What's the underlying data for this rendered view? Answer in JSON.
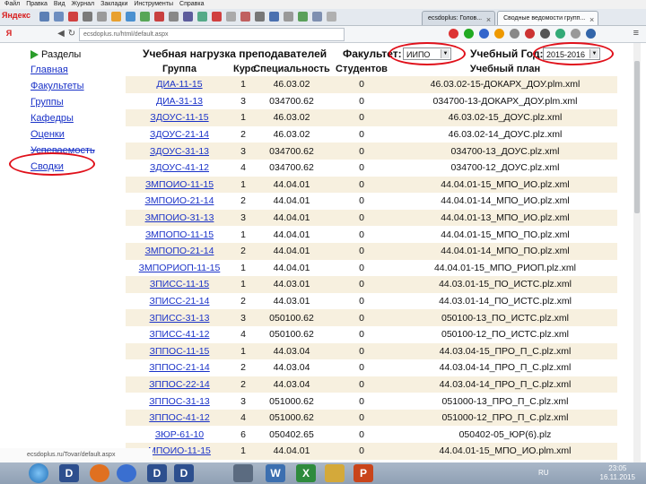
{
  "browser": {
    "menu": [
      "Файл",
      "Правка",
      "Вид",
      "Журнал",
      "Закладки",
      "Инструменты",
      "Справка"
    ],
    "brand": "Яндекс",
    "tabs": [
      {
        "label": "ecsdoplus: Голов..."
      },
      {
        "label": "Сводные ведомости групп..."
      }
    ],
    "url": "ecsdoplus.ru/html/default.aspx",
    "status_url": "ecsdoplus.ru/Tovar/default.aspx"
  },
  "sidebar": {
    "heading": "Разделы",
    "items": [
      "Главная",
      "Факультеты",
      "Группы",
      "Кафедры",
      "Оценки",
      "Успеваемость",
      "Сводки"
    ]
  },
  "header": {
    "title": "Учебная нагрузка преподавателей",
    "faculty_label": "Факультет:",
    "faculty_value": "ИИПО",
    "year_label": "Учебный Год:",
    "year_value": "2015-2016"
  },
  "table": {
    "columns": [
      "Группа",
      "Курс",
      "Специальность",
      "Студентов",
      "Учебный план"
    ],
    "rows": [
      [
        "ДИА-11-15",
        "1",
        "46.03.02",
        "0",
        "46.03.02-15-ДОКАРХ_ДОУ.plm.xml"
      ],
      [
        "ДИА-31-13",
        "3",
        "034700.62",
        "0",
        "034700-13-ДОКАРХ_ДОУ.plm.xml"
      ],
      [
        "ЗДОУС-11-15",
        "1",
        "46.03.02",
        "0",
        "46.03.02-15_ДОУС.plz.xml"
      ],
      [
        "ЗДОУС-21-14",
        "2",
        "46.03.02",
        "0",
        "46.03.02-14_ДОУС.plz.xml"
      ],
      [
        "ЗДОУС-31-13",
        "3",
        "034700.62",
        "0",
        "034700-13_ДОУС.plz.xml"
      ],
      [
        "ЗДОУС-41-12",
        "4",
        "034700.62",
        "0",
        "034700-12_ДОУС.plz.xml"
      ],
      [
        "ЗМПОИО-11-15",
        "1",
        "44.04.01",
        "0",
        "44.04.01-15_МПО_ИО.plz.xml"
      ],
      [
        "ЗМПОИО-21-14",
        "2",
        "44.04.01",
        "0",
        "44.04.01-14_МПО_ИО.plz.xml"
      ],
      [
        "ЗМПОИО-31-13",
        "3",
        "44.04.01",
        "0",
        "44.04.01-13_МПО_ИО.plz.xml"
      ],
      [
        "ЗМПОПО-11-15",
        "1",
        "44.04.01",
        "0",
        "44.04.01-15_МПО_ПО.plz.xml"
      ],
      [
        "ЗМПОПО-21-14",
        "2",
        "44.04.01",
        "0",
        "44.04.01-14_МПО_ПО.plz.xml"
      ],
      [
        "ЗМПОРИОП-11-15",
        "1",
        "44.04.01",
        "0",
        "44.04.01-15_МПО_РИОП.plz.xml"
      ],
      [
        "ЗПИСС-11-15",
        "1",
        "44.03.01",
        "0",
        "44.03.01-15_ПО_ИСТС.plz.xml"
      ],
      [
        "ЗПИСС-21-14",
        "2",
        "44.03.01",
        "0",
        "44.03.01-14_ПО_ИСТС.plz.xml"
      ],
      [
        "ЗПИСС-31-13",
        "3",
        "050100.62",
        "0",
        "050100-13_ПО_ИСТС.plz.xml"
      ],
      [
        "ЗПИСС-41-12",
        "4",
        "050100.62",
        "0",
        "050100-12_ПО_ИСТС.plz.xml"
      ],
      [
        "ЗППОС-11-15",
        "1",
        "44.03.04",
        "0",
        "44.03.04-15_ПРО_П_С.plz.xml"
      ],
      [
        "ЗППОС-21-14",
        "2",
        "44.03.04",
        "0",
        "44.03.04-14_ПРО_П_С.plz.xml"
      ],
      [
        "ЗППОС-22-14",
        "2",
        "44.03.04",
        "0",
        "44.03.04-14_ПРО_П_С.plz.xml"
      ],
      [
        "ЗППОС-31-13",
        "3",
        "051000.62",
        "0",
        "051000-13_ПРО_П_С.plz.xml"
      ],
      [
        "ЗППОС-41-12",
        "4",
        "051000.62",
        "0",
        "051000-12_ПРО_П_С.plz.xml"
      ],
      [
        "ЗЮР-61-10",
        "6",
        "050402.65",
        "0",
        "050402-05_ЮР(6).plz"
      ],
      [
        "МПОИО-11-15",
        "1",
        "44.04.01",
        "0",
        "44.04.01-15_МПО_ИО.plm.xml"
      ]
    ]
  },
  "taskbar": {
    "lang": "RU",
    "time": "23:05",
    "date": "16.11.2015"
  },
  "colors": {
    "link": "#1a32c8",
    "highlight_oval": "#e0101a",
    "row_alt": "#f7f0df"
  }
}
